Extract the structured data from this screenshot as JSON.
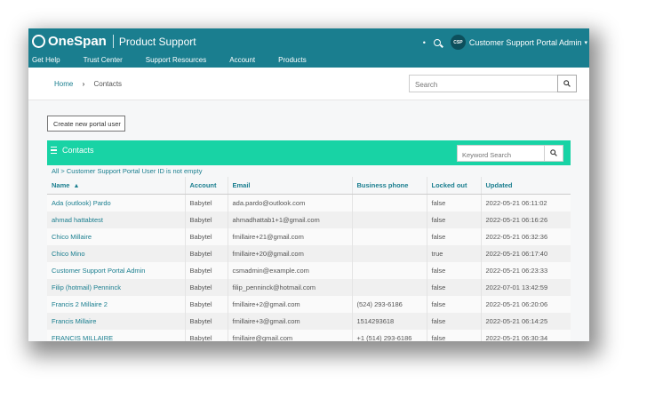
{
  "header": {
    "brand": "OneSpan",
    "product": "Product Support",
    "dot": "•",
    "avatar_initials": "CSP",
    "user_name": "Customer Support Portal Admin",
    "caret": "▾"
  },
  "nav": [
    "Get Help",
    "Trust Center",
    "Support Resources",
    "Account",
    "Products"
  ],
  "breadcrumb": {
    "home": "Home",
    "current": "Contacts"
  },
  "search": {
    "placeholder": "Search"
  },
  "new_button": "Create new portal user",
  "panel": {
    "title": "Contacts",
    "keyword_placeholder": "Keyword Search"
  },
  "filter_text": "All > Customer Support Portal User ID is not empty",
  "table": {
    "columns": [
      "Name",
      "Account",
      "Email",
      "Business phone",
      "Locked out",
      "Updated"
    ],
    "sort_indicator": "▲",
    "rows": [
      [
        "Ada (outlook) Pardo",
        "Babytel",
        "ada.pardo@outlook.com",
        "",
        "false",
        "2022-05-21 06:11:02"
      ],
      [
        "ahmad hattabtest",
        "Babytel",
        "ahmadhattab1+1@gmail.com",
        "",
        "false",
        "2022-05-21 06:16:26"
      ],
      [
        "Chico Millaire",
        "Babytel",
        "fmillaire+21@gmail.com",
        "",
        "false",
        "2022-05-21 06:32:36"
      ],
      [
        "Chico Mino",
        "Babytel",
        "fmillaire+20@gmail.com",
        "",
        "true",
        "2022-05-21 06:17:40"
      ],
      [
        "Customer Support Portal Admin",
        "Babytel",
        "csmadmin@example.com",
        "",
        "false",
        "2022-05-21 06:23:33"
      ],
      [
        "Filip (hotmail) Penninck",
        "Babytel",
        "filip_penninck@hotmail.com",
        "",
        "false",
        "2022-07-01 13:42:59"
      ],
      [
        "Francis 2 Millaire 2",
        "Babytel",
        "fmillaire+2@gmail.com",
        "(524) 293-6186",
        "false",
        "2022-05-21 06:20:06"
      ],
      [
        "Francis Millaire",
        "Babytel",
        "fmillaire+3@gmail.com",
        "1514293618",
        "false",
        "2022-05-21 06:14:25"
      ],
      [
        "FRANCIS MILLAIRE",
        "Babytel",
        "fmillaire@gmail.com",
        "+1 (514) 293-6186",
        "false",
        "2022-05-21 06:30:34"
      ]
    ]
  }
}
